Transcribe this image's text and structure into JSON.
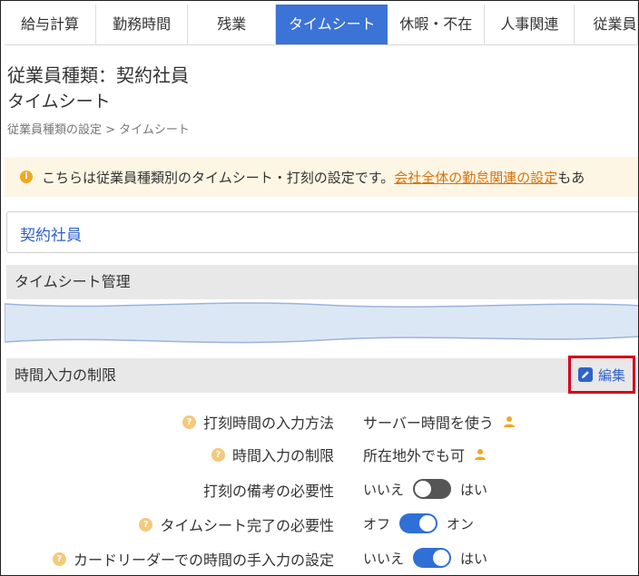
{
  "tabs": [
    "給与計算",
    "勤務時間",
    "残業",
    "タイムシート",
    "休暇・不在",
    "人事関連",
    "従業員"
  ],
  "active_tab": "タイムシート",
  "page": {
    "title": "従業員種類：契約社員",
    "subtitle": "タイムシート",
    "breadcrumb": "従業員種類の設定 > タイムシート"
  },
  "notice": {
    "text_before": "こちらは従業員種類別のタイムシート・打刻の設定です。",
    "link": "会社全体の勤怠関連の設定",
    "text_after": "もあ"
  },
  "contract_label": "契約社員",
  "sections": {
    "timesheet_management": "タイムシート管理",
    "time_input_limits": "時間入力の制限",
    "edit_label": "編集"
  },
  "settings": [
    {
      "label": "打刻時間の入力方法",
      "help": true,
      "value": "サーバー時間を使う",
      "person_icon": true
    },
    {
      "label": "時間入力の制限",
      "help": true,
      "value": "所在地外でも可",
      "person_icon": true
    },
    {
      "label": "打刻の備考の必要性",
      "help": false,
      "toggle_off_label": "いいえ",
      "toggle_on_label": "はい",
      "toggle_state": "off"
    },
    {
      "label": "タイムシート完了の必要性",
      "help": true,
      "toggle_off_label": "オフ",
      "toggle_on_label": "オン",
      "toggle_state": "on"
    },
    {
      "label": "カードリーダーでの時間の手入力の設定",
      "help": true,
      "toggle_off_label": "いいえ",
      "toggle_on_label": "はい",
      "toggle_state": "on"
    }
  ],
  "colors": {
    "accent": "#3b73d6",
    "link_orange": "#d9730d",
    "highlight_red": "#d6001c"
  }
}
